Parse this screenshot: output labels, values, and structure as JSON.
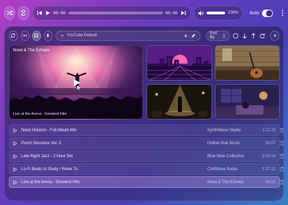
{
  "player": {
    "time_current": "00:00",
    "time_total": "00:00",
    "progress": 0,
    "volume_percent": "100%",
    "volume_level": 1.0,
    "auto_label": "Auto",
    "auto_enabled": true
  },
  "toolbar": {
    "playlist_name": "YouTube Default",
    "sort_label": "Sort By"
  },
  "featured": {
    "title": "Nova & The Echoes",
    "caption": "Live at the Arena - Greatest Hits"
  },
  "tracks": [
    {
      "title": "Neon Horizon - Full Album Mix",
      "artist": "SynthWave Studio",
      "duration": "1:11:23",
      "active": false
    },
    {
      "title": "Porch Sessions Vol. 3",
      "artist": "Hollow Oak Music",
      "duration": "53:07",
      "active": false
    },
    {
      "title": "Late Night Jazz - 2 Hour Set",
      "artist": "Blue Note Collective",
      "duration": "2:03:14",
      "active": false
    },
    {
      "title": "Lo-Fi Beats to Study / Relax To",
      "artist": "ChillWave Radio",
      "duration": "1:37:12",
      "active": false
    },
    {
      "title": "Live at the Arena - Greatest Hits",
      "artist": "Nova & The Echoes",
      "duration": "48:51",
      "active": true
    }
  ],
  "colors": {
    "accent": "#ffffff",
    "active_row": "#c9a6ff"
  }
}
